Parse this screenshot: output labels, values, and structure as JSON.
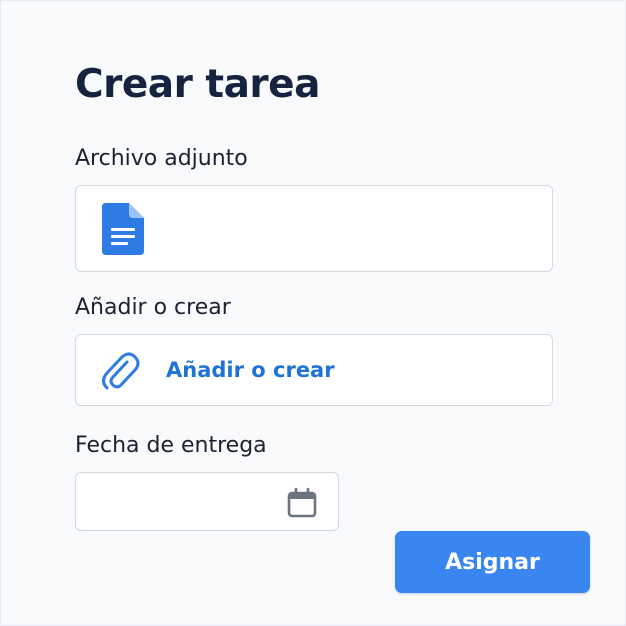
{
  "dialog": {
    "title": "Crear tarea"
  },
  "attachment": {
    "label": "Archivo adjunto",
    "icon": "document-icon"
  },
  "add_or_create": {
    "label": "Añadir o crear",
    "button_label": "Añadir o crear",
    "icon": "paperclip-icon"
  },
  "due_date": {
    "label": "Fecha de entrega",
    "value": "",
    "icon": "calendar-icon"
  },
  "actions": {
    "assign_label": "Asignar"
  },
  "colors": {
    "accent": "#3a86f0",
    "link": "#1f73d6",
    "title": "#16233f"
  }
}
